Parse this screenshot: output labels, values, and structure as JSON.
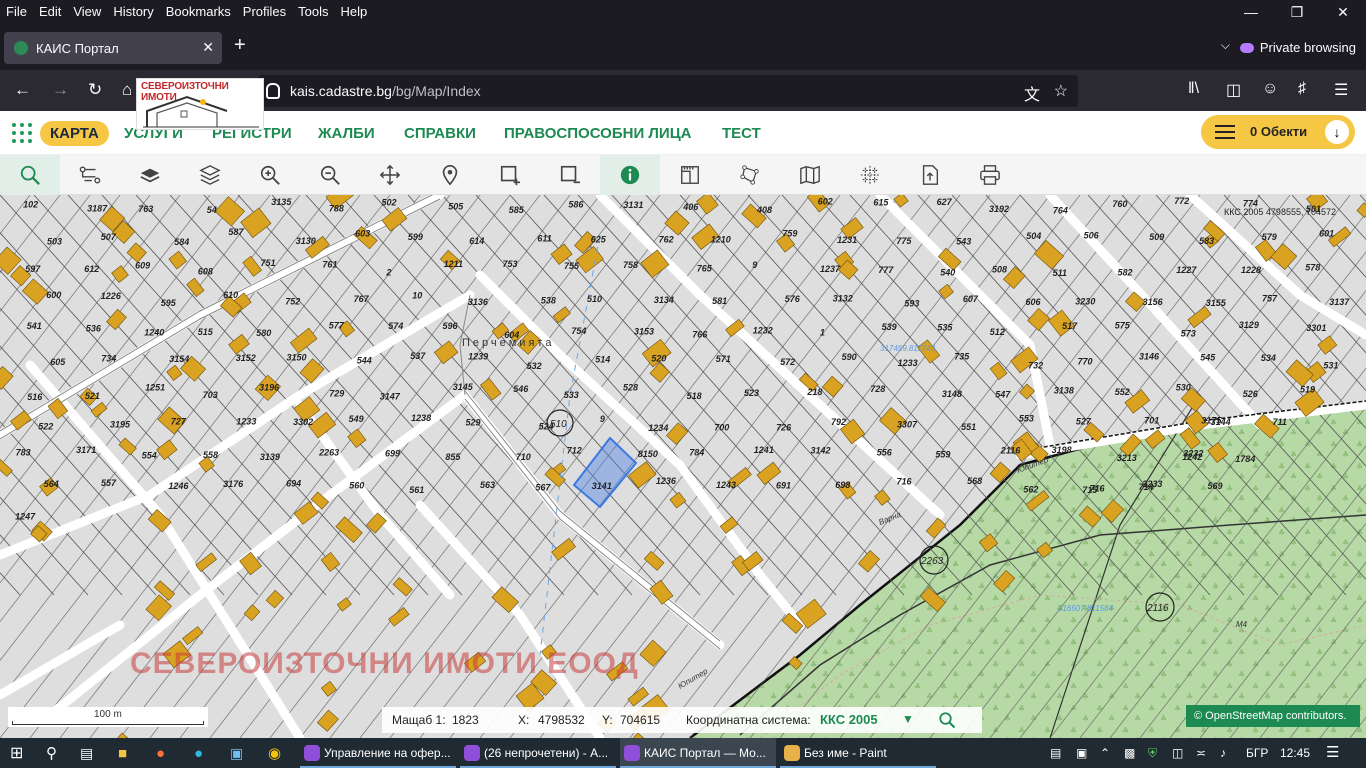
{
  "menu": [
    "File",
    "Edit",
    "View",
    "History",
    "Bookmarks",
    "Profiles",
    "Tools",
    "Help"
  ],
  "tab": {
    "title": "КАИС Портал"
  },
  "private_label": "Private browsing",
  "url": {
    "domain": "kais.cadastre.bg",
    "path": "/bg/Map/Index"
  },
  "logo": {
    "text": "СЕВЕРОИЗТОЧНИ ИМОТИ"
  },
  "app_nav": {
    "home": "КАРТА",
    "links": [
      "УСЛУГИ",
      "РЕГИСТРИ",
      "ЖАЛБИ",
      "СПРАВКИ",
      "ПРАВОСПОСОБНИ ЛИЦА",
      "ТЕСТ"
    ],
    "objects": "0 Обекти"
  },
  "map": {
    "coords_top": "ККС 2005 4798555, 704572",
    "street": "Перчемията",
    "watermark": "СЕВЕРОИЗТОЧНИ ИМОТИ ЕООД",
    "parcels": [
      "102",
      "3187",
      "763",
      "54",
      "3135",
      "788",
      "502",
      "505",
      "585",
      "586",
      "3131",
      "406",
      "408",
      "602",
      "615",
      "627",
      "3192",
      "764",
      "760",
      "772",
      "774",
      "501",
      "503",
      "507",
      "584",
      "587",
      "3130",
      "603",
      "599",
      "614",
      "611",
      "625",
      "762",
      "1210",
      "759",
      "1231",
      "775",
      "543",
      "504",
      "506",
      "509",
      "583",
      "579",
      "601",
      "597",
      "612",
      "609",
      "608",
      "751",
      "761",
      "2",
      "1211",
      "753",
      "755",
      "758",
      "765",
      "9",
      "1237",
      "777",
      "540",
      "508",
      "511",
      "582",
      "1227",
      "1228",
      "578",
      "600",
      "1226",
      "595",
      "610",
      "752",
      "767",
      "10",
      "3136",
      "538",
      "510",
      "3134",
      "581",
      "576",
      "3132",
      "593",
      "607",
      "606",
      "3230",
      "3156",
      "3155",
      "757",
      "3137",
      "541",
      "536",
      "1240",
      "515",
      "580",
      "577",
      "574",
      "596",
      "604",
      "754",
      "3153",
      "766",
      "1232",
      "1",
      "539",
      "535",
      "512",
      "517",
      "575",
      "573",
      "3129",
      "3301",
      "605",
      "734",
      "3154",
      "3152",
      "3150",
      "544",
      "537",
      "1239",
      "532",
      "514",
      "520",
      "571",
      "572",
      "590",
      "1233",
      "735",
      "732",
      "770",
      "3146",
      "545",
      "534",
      "531",
      "516",
      "521",
      "1251",
      "703",
      "3196",
      "729",
      "3147",
      "3145",
      "546",
      "533",
      "528",
      "518",
      "523",
      "218",
      "728",
      "3148",
      "547",
      "3138",
      "552",
      "530",
      "526",
      "519",
      "522",
      "3195",
      "727",
      "1233",
      "3302",
      "549",
      "1238",
      "529",
      "524",
      "9",
      "1234",
      "700",
      "726",
      "792",
      "3307",
      "551",
      "553",
      "527",
      "701",
      "3175",
      "711",
      "3144",
      "783",
      "3171",
      "554",
      "558",
      "3139",
      "2263",
      "699",
      "855",
      "710",
      "712",
      "8150",
      "784",
      "1241",
      "3142",
      "556",
      "559",
      "2116",
      "3198",
      "3213",
      "1242",
      "1784",
      "3232",
      "564",
      "557",
      "1246",
      "3176",
      "694",
      "560",
      "561",
      "563",
      "567",
      "3141",
      "1236",
      "1243",
      "691",
      "698",
      "716",
      "568",
      "562",
      "715",
      "714",
      "716",
      "3233",
      "569",
      "1247"
    ],
    "circle_labels": [
      "510",
      "2263",
      "2116"
    ],
    "blue_labels": [
      "317459.811740",
      "316507.811584"
    ],
    "street_labels": [
      "Юпитер",
      "Варна",
      "Юпитер",
      "M4"
    ]
  },
  "scale": {
    "label": "100 m"
  },
  "status": {
    "scale_label": "Мащаб 1:",
    "scale_value": "1823",
    "x_label": "X:",
    "x_value": "4798532",
    "y_label": "Y:",
    "y_value": "704615",
    "system_label": "Координатна система:",
    "system_value": "ККС 2005"
  },
  "osm": "© OpenStreetMap contributors.",
  "taskbar": {
    "apps": [
      "Управление на офер...",
      "(26 непрочетени) - А...",
      "КАИС Портал — Мо...",
      "Без име - Paint"
    ],
    "lang": "БГР",
    "time": "12:45"
  }
}
